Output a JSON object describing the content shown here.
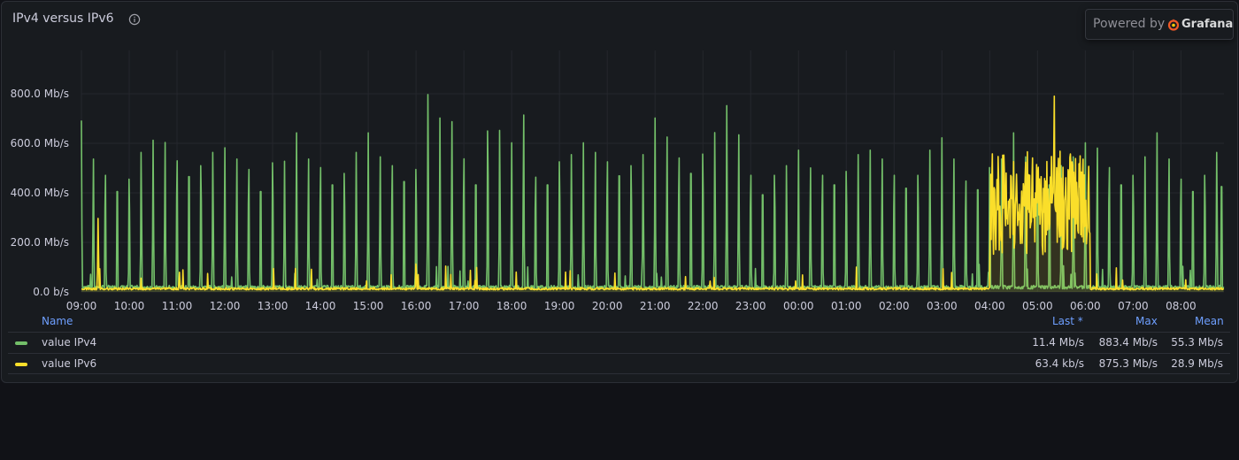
{
  "panel": {
    "title": "IPv4 versus IPv6",
    "powered_by_label": "Powered by",
    "brand": "Grafana"
  },
  "legend": {
    "headers": {
      "name": "Name",
      "last": "Last *",
      "max": "Max",
      "mean": "Mean"
    },
    "series": [
      {
        "name": "value IPv4",
        "color": "#73bf69",
        "last": "11.4 Mb/s",
        "max": "883.4 Mb/s",
        "mean": "55.3 Mb/s"
      },
      {
        "name": "value IPv6",
        "color": "#fade2a",
        "last": "63.4 kb/s",
        "max": "875.3 Mb/s",
        "mean": "28.9 Mb/s"
      }
    ]
  },
  "chart_data": {
    "type": "line",
    "ylim": [
      0,
      975
    ],
    "y_ticks": [
      {
        "value": 0,
        "label": "0.0 b/s"
      },
      {
        "value": 200,
        "label": "200.0 Mb/s"
      },
      {
        "value": 400,
        "label": "400.0 Mb/s"
      },
      {
        "value": 600,
        "label": "600.0 Mb/s"
      },
      {
        "value": 800,
        "label": "800.0 Mb/s"
      }
    ],
    "x_ticks": [
      "09:00",
      "10:00",
      "11:00",
      "12:00",
      "13:00",
      "14:00",
      "15:00",
      "16:00",
      "17:00",
      "18:00",
      "19:00",
      "20:00",
      "21:00",
      "22:00",
      "23:00",
      "00:00",
      "01:00",
      "02:00",
      "03:00",
      "04:00",
      "05:00",
      "06:00",
      "07:00",
      "08:00"
    ],
    "x_range_hours": [
      0,
      23.9
    ],
    "series": [
      {
        "name": "value IPv4",
        "color": "#73bf69",
        "baseline": 12,
        "spikes": [
          [
            0.0,
            680
          ],
          [
            0.25,
            590
          ],
          [
            0.5,
            590
          ],
          [
            0.75,
            590
          ],
          [
            1.0,
            570
          ],
          [
            1.25,
            620
          ],
          [
            1.5,
            600
          ],
          [
            1.75,
            665
          ],
          [
            2.0,
            665
          ],
          [
            2.25,
            680
          ],
          [
            2.5,
            640
          ],
          [
            2.75,
            620
          ],
          [
            3.0,
            570
          ],
          [
            3.25,
            590
          ],
          [
            3.5,
            620
          ],
          [
            3.75,
            590
          ],
          [
            4.0,
            655
          ],
          [
            4.25,
            580
          ],
          [
            4.5,
            630
          ],
          [
            4.75,
            590
          ],
          [
            5.0,
            630
          ],
          [
            5.25,
            630
          ],
          [
            5.5,
            600
          ],
          [
            5.75,
            620
          ],
          [
            6.0,
            630
          ],
          [
            6.25,
            600
          ],
          [
            6.5,
            640
          ],
          [
            6.75,
            650
          ],
          [
            7.0,
            620
          ],
          [
            7.25,
            883
          ],
          [
            7.5,
            690
          ],
          [
            7.75,
            760
          ],
          [
            8.0,
            675
          ],
          [
            8.25,
            630
          ],
          [
            8.5,
            820
          ],
          [
            8.75,
            720
          ],
          [
            9.0,
            590
          ],
          [
            9.25,
            790
          ],
          [
            9.5,
            580
          ],
          [
            9.75,
            630
          ],
          [
            10.0,
            660
          ],
          [
            10.25,
            610
          ],
          [
            10.5,
            590
          ],
          [
            10.75,
            620
          ],
          [
            11.0,
            660
          ],
          [
            11.25,
            685
          ],
          [
            11.5,
            640
          ],
          [
            11.75,
            610
          ],
          [
            12.0,
            690
          ],
          [
            12.25,
            690
          ],
          [
            12.5,
            680
          ],
          [
            12.75,
            700
          ],
          [
            13.0,
            700
          ],
          [
            13.25,
            710
          ],
          [
            13.5,
            740
          ],
          [
            13.75,
            700
          ],
          [
            14.0,
            590
          ],
          [
            14.25,
            570
          ],
          [
            14.5,
            590
          ],
          [
            14.75,
            560
          ],
          [
            15.0,
            560
          ],
          [
            15.25,
            550
          ],
          [
            15.5,
            590
          ],
          [
            15.75,
            630
          ],
          [
            16.0,
            610
          ],
          [
            16.25,
            610
          ],
          [
            16.5,
            560
          ],
          [
            16.75,
            590
          ],
          [
            17.0,
            590
          ],
          [
            17.25,
            610
          ],
          [
            17.5,
            590
          ],
          [
            17.75,
            630
          ],
          [
            18.0,
            610
          ],
          [
            18.25,
            590
          ],
          [
            18.5,
            560
          ],
          [
            18.75,
            600
          ],
          [
            19.0,
            630
          ],
          [
            19.25,
            590
          ],
          [
            19.5,
            630
          ],
          [
            19.75,
            600
          ],
          [
            20.0,
            610
          ],
          [
            20.25,
            630
          ],
          [
            20.5,
            640
          ],
          [
            20.75,
            600
          ],
          [
            21.0,
            590
          ],
          [
            21.25,
            640
          ],
          [
            21.5,
            630
          ],
          [
            21.75,
            630
          ],
          [
            22.0,
            590
          ],
          [
            22.25,
            600
          ],
          [
            22.5,
            630
          ],
          [
            22.75,
            590
          ],
          [
            23.0,
            570
          ],
          [
            23.25,
            590
          ],
          [
            23.5,
            590
          ],
          [
            23.75,
            620
          ],
          [
            23.85,
            620
          ]
        ]
      },
      {
        "name": "value IPv6",
        "color": "#fade2a",
        "baseline": 8,
        "spikes": [
          [
            0.35,
            325
          ],
          [
            2.05,
            80
          ],
          [
            7.0,
            135
          ],
          [
            13.15,
            40
          ],
          [
            19.1,
            520
          ],
          [
            19.3,
            700
          ],
          [
            19.5,
            500
          ],
          [
            19.75,
            580
          ],
          [
            20.0,
            590
          ],
          [
            20.35,
            880
          ],
          [
            20.5,
            580
          ],
          [
            20.75,
            290
          ],
          [
            21.0,
            260
          ]
        ],
        "burst": [
          19.0,
          21.1
        ]
      }
    ]
  }
}
